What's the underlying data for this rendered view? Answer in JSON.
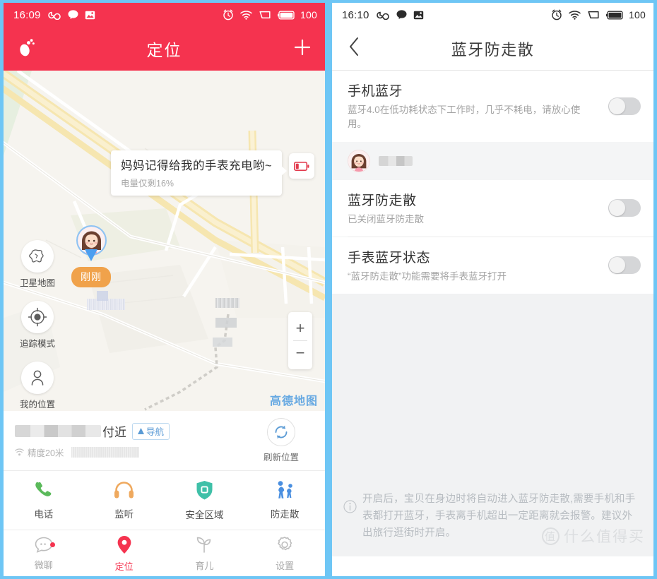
{
  "left": {
    "status": {
      "time": "16:09",
      "battery": "100",
      "icons": [
        "infinity-icon",
        "chat-bubble-icon",
        "image-icon",
        "alarm-clock-icon",
        "wifi-icon",
        "signal-icon",
        "battery-icon"
      ]
    },
    "appbar": {
      "title": "定位",
      "left_icon": "footprint-icon",
      "right_icon": "plus-icon"
    },
    "map": {
      "bubble_title": "妈妈记得给我的手表充电哟~",
      "bubble_sub": "电量仅剩16%",
      "battery_icon": "low-battery-icon",
      "time_badge": "刚刚",
      "buttons": [
        {
          "label": "卫星地图",
          "icon": "satellite-map-icon"
        },
        {
          "label": "追踪模式",
          "icon": "target-icon"
        },
        {
          "label": "我的位置",
          "icon": "person-icon"
        }
      ],
      "zoom_in": "+",
      "zoom_out": "−",
      "provider": "高德地图"
    },
    "address": {
      "nearby_suffix": "付近",
      "nav_label": "导航",
      "accuracy": "精度20米",
      "refresh_label": "刷新位置",
      "refresh_icon": "refresh-icon",
      "wifi_icon": "wifi-small-icon"
    },
    "actions": [
      {
        "label": "电话",
        "icon": "phone-icon",
        "color": "#5bba5b"
      },
      {
        "label": "监听",
        "icon": "headphone-icon",
        "color": "#efa95e"
      },
      {
        "label": "安全区域",
        "icon": "shield-icon",
        "color": "#3fc0a8"
      },
      {
        "label": "防走散",
        "icon": "family-icon",
        "color": "#4a8fe0"
      }
    ],
    "tabs": [
      {
        "label": "微聊",
        "icon": "chat-icon",
        "active": false,
        "badge": true
      },
      {
        "label": "定位",
        "icon": "location-pin-icon",
        "active": true,
        "badge": false
      },
      {
        "label": "育儿",
        "icon": "sprout-icon",
        "active": false,
        "badge": false
      },
      {
        "label": "设置",
        "icon": "gear-icon",
        "active": false,
        "badge": false
      }
    ]
  },
  "right": {
    "status": {
      "time": "16:10",
      "battery": "100"
    },
    "appbar": {
      "title": "蓝牙防走散",
      "back_icon": "chevron-left-icon"
    },
    "rows": [
      {
        "title": "手机蓝牙",
        "sub": "蓝牙4.0在低功耗状态下工作时，几乎不耗电，请放心使用。",
        "toggle": "off"
      },
      {
        "title": "蓝牙防走散",
        "sub": "已关闭蓝牙防走散",
        "toggle": "off"
      },
      {
        "title": "手表蓝牙状态",
        "sub": "“蓝牙防走散”功能需要将手表蓝牙打开",
        "toggle": "off"
      }
    ],
    "device": {
      "avatar_icon": "girl-avatar-icon",
      "name_masked": true
    },
    "note": {
      "icon": "info-icon",
      "text": "开启后，宝贝在身边时将自动进入蓝牙防走散,需要手机和手表都打开蓝牙，手表离手机超出一定距离就会报警。建议外出旅行逛街时开启。"
    },
    "watermark": {
      "mark": "值",
      "text": "什么值得买"
    }
  },
  "colors": {
    "brand_red": "#f5334f",
    "accent_blue": "#4a8fe0",
    "frame": "#6ec6f5"
  }
}
